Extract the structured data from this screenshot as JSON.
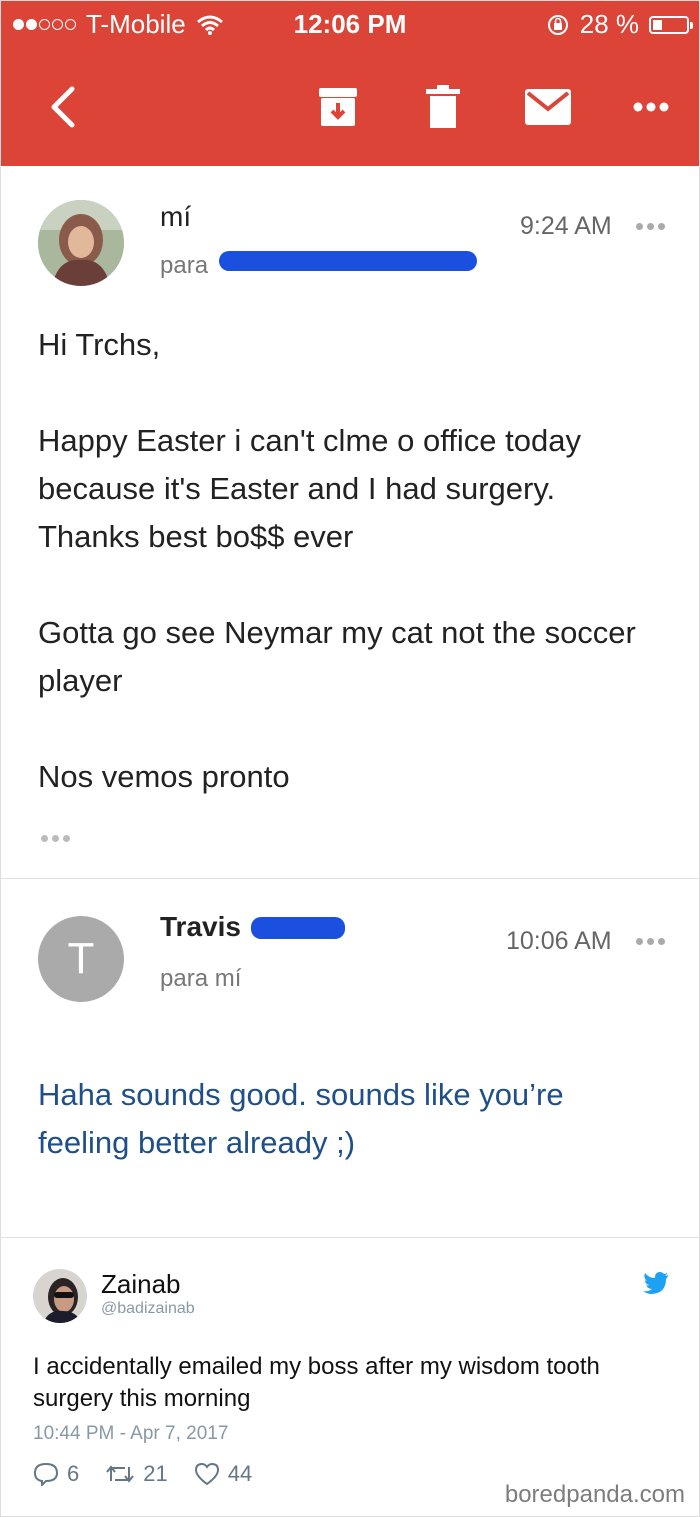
{
  "status_bar": {
    "carrier": "T-Mobile",
    "time": "12:06 PM",
    "battery": "28 %",
    "battery_level": 0.28
  },
  "toolbar": {
    "back_icon": "back-arrow-icon",
    "archive_icon": "archive-icon",
    "delete_icon": "trash-icon",
    "mail_icon": "mail-icon",
    "more_icon": "more-icon"
  },
  "email1": {
    "sender": "mí",
    "to_prefix": "para",
    "time": "9:24 AM",
    "greeting": "Hi Trchs,",
    "paragraph1": "Happy Easter i can't clme o office today because it's Easter and I had surgery. Thanks  best bo$$ ever",
    "paragraph2": "Gotta go see Neymar my cat not the soccer player",
    "paragraph3": "Nos vemos pronto"
  },
  "email2": {
    "sender": "Travis",
    "to": "para mí",
    "time": "10:06 AM",
    "avatar_letter": "T",
    "body": "Haha sounds good. sounds like you’re feeling better already ;)"
  },
  "tweet": {
    "name": "Zainab",
    "handle": "@badizainab",
    "text": "I accidentally emailed my boss after my wisdom tooth surgery this morning",
    "timestamp": "10:44 PM - Apr 7, 2017",
    "replies": "6",
    "retweets": "21",
    "likes": "44"
  },
  "watermark": "boredpanda.com",
  "colors": {
    "toolbar_red": "#db4437",
    "reply_blue": "#1f4f8a",
    "twitter_blue": "#1da1f2",
    "redaction_blue": "#1a4fe0"
  }
}
